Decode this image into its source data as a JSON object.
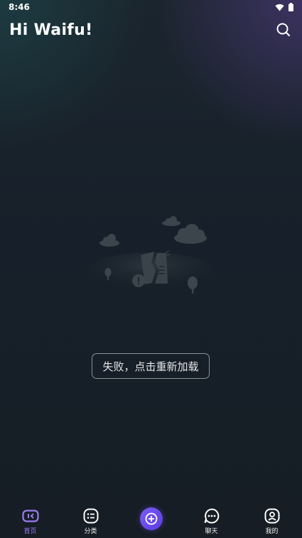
{
  "status_bar": {
    "time": "8:46",
    "icons": [
      "wifi-icon",
      "battery-icon"
    ]
  },
  "header": {
    "title": "Hi Waifu!",
    "search_icon": "search-icon"
  },
  "error_state": {
    "illustration": "broken-paper-clouds-illustration",
    "reload_label": "失败，点击重新加载"
  },
  "bottom_nav": {
    "items": [
      {
        "label": "首页",
        "icon": "home-icon",
        "active": true
      },
      {
        "label": "分类",
        "icon": "category-icon",
        "active": false
      },
      {
        "label": "",
        "icon": "plus-icon",
        "active": false
      },
      {
        "label": "聊天",
        "icon": "chat-icon",
        "active": false
      },
      {
        "label": "我的",
        "icon": "profile-icon",
        "active": false
      }
    ]
  },
  "colors": {
    "accent": "#9b7cf0",
    "create_button": "#6a4df0",
    "background": "#161d24"
  }
}
